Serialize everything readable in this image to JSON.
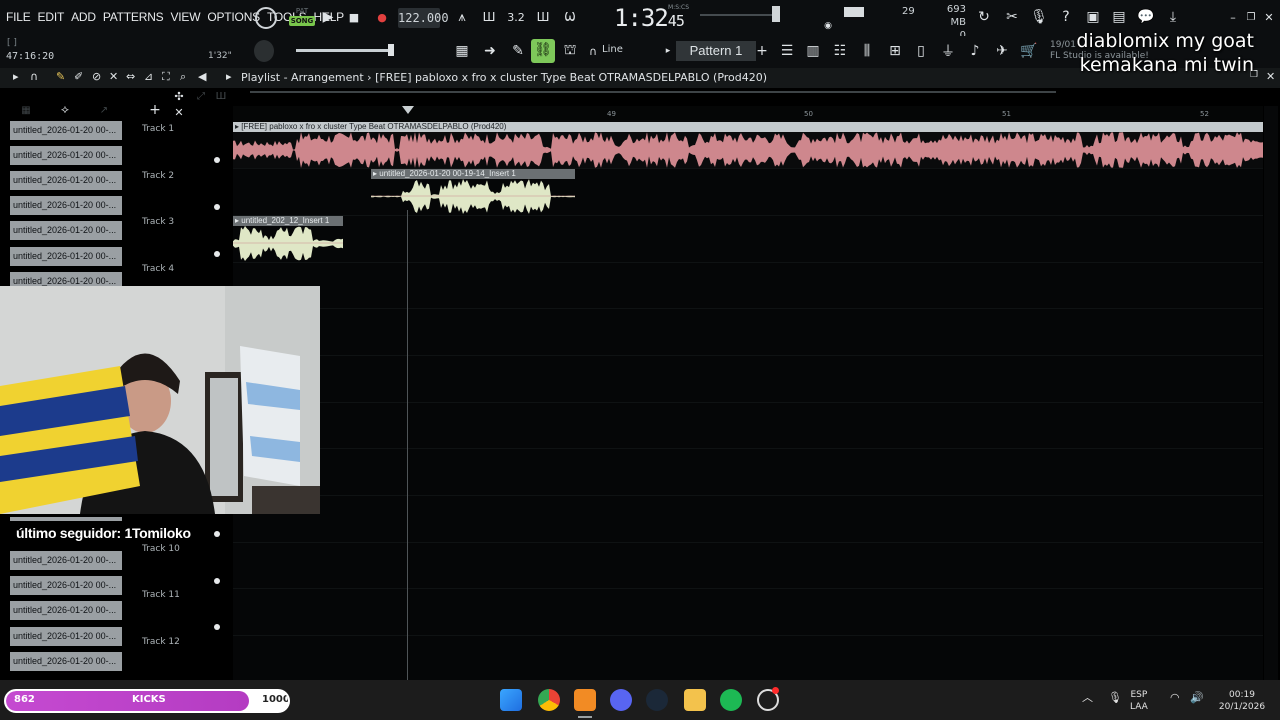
{
  "menu": [
    "FILE",
    "EDIT",
    "ADD",
    "PATTERNS",
    "VIEW",
    "OPTIONS",
    "TOOLS",
    "HELP"
  ],
  "transport": {
    "pat_label": "PAT",
    "song_label": "SONG",
    "tempo": "122.000",
    "time_main": "1:32",
    "time_sub": "45",
    "time_unit": "M:S:CS",
    "cpu_value": "29",
    "mem_value": "693 MB",
    "mem_zero": "0"
  },
  "toolbar2": {
    "brackets": "[ ]",
    "position": "47:16:20",
    "length": "1'32\"",
    "snap": "Line",
    "pattern": "Pattern 1",
    "news_date": "19/01",
    "news_text": "FL Studio is available!"
  },
  "playlist": {
    "title": "Playlist - Arrangement",
    "separator": "›",
    "project": "[FREE] pabloxo x fro x cluster  Type Beat  OTRAMASDELPABLO  (Prod420)",
    "ruler": [
      "49",
      "50",
      "51",
      "52"
    ],
    "clip_list": [
      "untitled_2026-01-20 00-...",
      "untitled_2026-01-20 00-...",
      "untitled_2026-01-20 00-...",
      "untitled_2026-01-20 00-...",
      "untitled_2026-01-20 00-...",
      "untitled_2026-01-20 00-...",
      "untitled_2026-01-20 00-..."
    ],
    "clip_list_lower": [
      "untitled_2026-01-20 00-...",
      "untitled_2026-01-20 00-...",
      "untitled_2026-01-20 00-...",
      "untitled_2026-01-20 00-...",
      "untitled_2026-01-20 00-...",
      "untitled_2026-01-20 00-..."
    ],
    "tracks_upper": [
      "Track 1",
      "Track 2",
      "Track 3",
      "Track 4"
    ],
    "tracks_lower": [
      "Track 10",
      "Track 11",
      "Track 12"
    ],
    "clips": {
      "beat": "[FREE] pabloxo x fro x cluster  Type Beat  OTRAMASDELPABLO  (Prod420)",
      "vocal1": "untitled_2026-01-20 00-19-14_Insert 1",
      "vocal2": "untitled_202_12_Insert 1"
    }
  },
  "overlay": {
    "caption_line1": "diablomix my goat",
    "caption_line2": "kemakana mi twin",
    "follower": "último seguidor: 1Tomiloko",
    "goal_current": "862",
    "goal_label": "KICKS",
    "goal_max": "1000",
    "goal_fraction": 0.862
  },
  "taskbar": {
    "lang_line1": "ESP",
    "lang_line2": "LAA",
    "clock_time": "00:19",
    "clock_date": "20/1/2026"
  },
  "colors": {
    "beat_clip": "#d98e95",
    "beat_header": "#c9d0d4",
    "vocal_clip": "#dfe7c6",
    "accent_green": "#7ec85a",
    "goal_fill": "#c54ad1"
  }
}
